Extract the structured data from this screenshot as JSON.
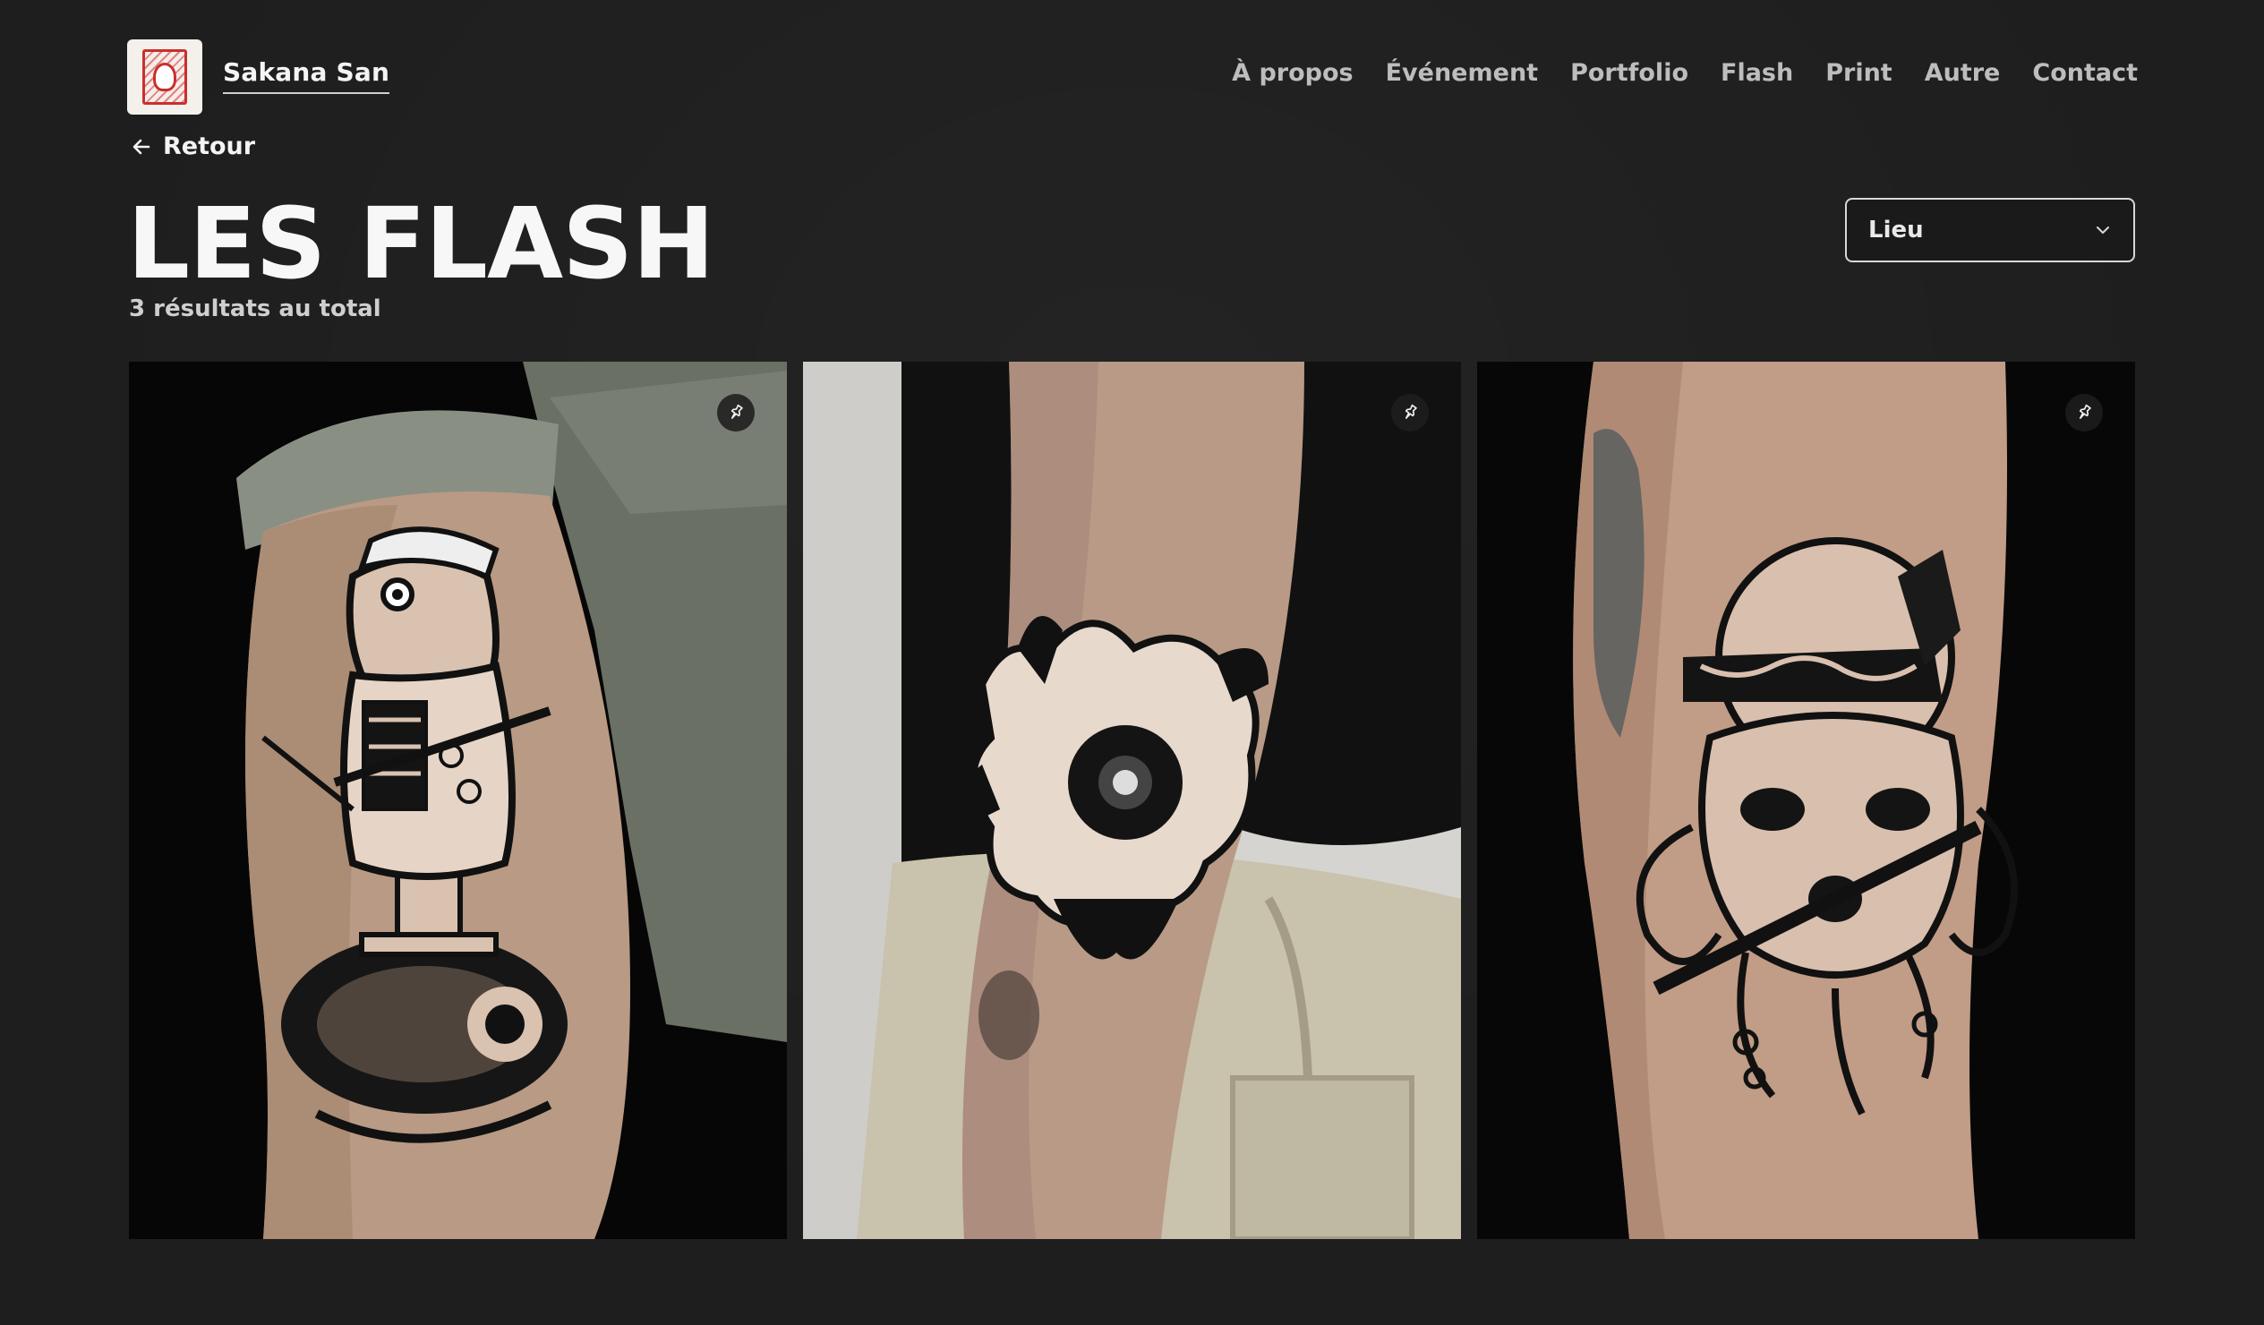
{
  "header": {
    "brand_name": "Sakana San",
    "logo_icon": "koi-card-logo-icon",
    "nav": [
      {
        "label": "À propos"
      },
      {
        "label": "Événement"
      },
      {
        "label": "Portfolio"
      },
      {
        "label": "Flash"
      },
      {
        "label": "Print"
      },
      {
        "label": "Autre"
      },
      {
        "label": "Contact"
      }
    ]
  },
  "back": {
    "label": "Retour",
    "icon": "arrow-left-icon"
  },
  "page": {
    "title": "LES FLASH",
    "result_count": "3 résultats au total"
  },
  "filter": {
    "selected": "Lieu",
    "icon": "chevron-down-icon"
  },
  "gallery": {
    "items": [
      {
        "subject": "samurai-frog-on-catfish-tattoo",
        "pin_icon": "pin-icon"
      },
      {
        "subject": "peony-flower-forearm-tattoo",
        "pin_icon": "pin-icon"
      },
      {
        "subject": "octopus-with-headband-and-knife-tattoo",
        "pin_icon": "pin-icon"
      }
    ]
  },
  "colors": {
    "background": "#1e1e1e",
    "text": "#f4f4f4",
    "nav_text": "#bdbdbd",
    "logo_red": "#c9302c"
  }
}
